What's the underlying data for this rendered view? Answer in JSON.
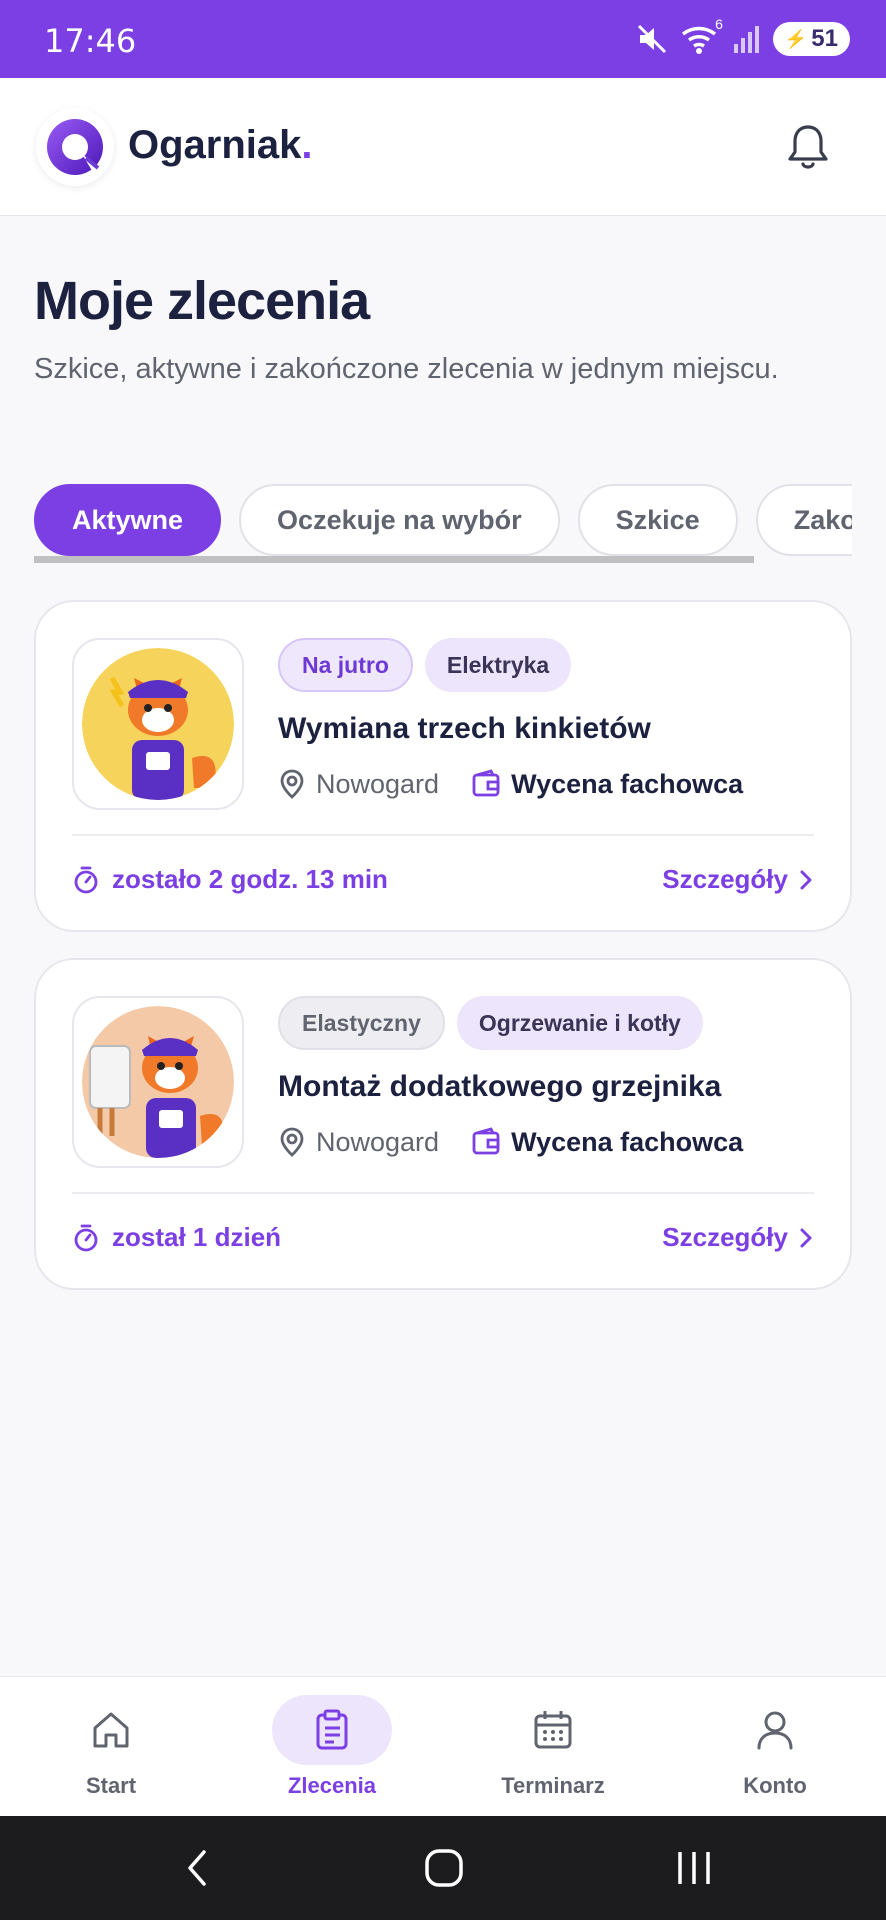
{
  "status_bar": {
    "time": "17:46",
    "wifi_badge": "6",
    "battery": "51",
    "icons": [
      "mute-icon",
      "wifi-icon",
      "signal-icon",
      "battery-icon"
    ]
  },
  "app_bar": {
    "brand": "Ogarniak",
    "brand_dot": "."
  },
  "page": {
    "title": "Moje zlecenia",
    "subtitle": "Szkice, aktywne i zakończone zlecenia w jednym miejscu."
  },
  "tabs": [
    {
      "label": "Aktywne",
      "active": true
    },
    {
      "label": "Oczekuje na wybór",
      "active": false
    },
    {
      "label": "Szkice",
      "active": false
    },
    {
      "label": "Zakończone",
      "active": false
    }
  ],
  "orders": [
    {
      "tags": [
        "Na jutro",
        "Elektryka"
      ],
      "title": "Wymiana trzech kinkietów",
      "location": "Nowogard",
      "price": "Wycena fachowca",
      "time_left": "zostało 2 godz. 13 min",
      "details_label": "Szczegóły"
    },
    {
      "tags": [
        "Elastyczny",
        "Ogrzewanie i kotły"
      ],
      "title": "Montaż dodatkowego grzejnika",
      "location": "Nowogard",
      "price": "Wycena fachowca",
      "time_left": "został 1 dzień",
      "details_label": "Szczegóły"
    }
  ],
  "bottom_nav": [
    {
      "label": "Start",
      "icon": "home-icon",
      "active": false
    },
    {
      "label": "Zlecenia",
      "icon": "clipboard-icon",
      "active": true
    },
    {
      "label": "Terminarz",
      "icon": "calendar-icon",
      "active": false
    },
    {
      "label": "Konto",
      "icon": "user-icon",
      "active": false
    }
  ],
  "colors": {
    "accent": "#7b3fe4",
    "text_dark": "#1d2140",
    "text_muted": "#60646f"
  }
}
